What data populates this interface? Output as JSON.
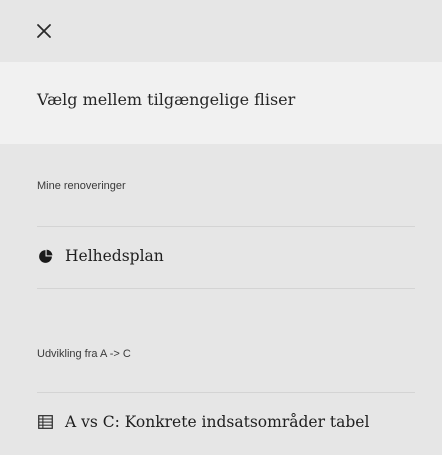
{
  "header": {
    "close_icon": "close-icon",
    "title": "Vælg mellem tilgængelige fliser"
  },
  "sections": [
    {
      "label": "Mine renoveringer",
      "items": [
        {
          "icon": "pie-chart-icon",
          "label": "Helhedsplan"
        }
      ]
    },
    {
      "label": "Udvikling fra A -> C",
      "items": [
        {
          "icon": "table-icon",
          "label": "A vs C: Konkrete indsatsområder tabel"
        }
      ]
    }
  ],
  "colors": {
    "background": "#e6e6e6",
    "title_band": "#f1f1f1",
    "divider": "#d4d4d4",
    "text": "#1e1e1e"
  }
}
